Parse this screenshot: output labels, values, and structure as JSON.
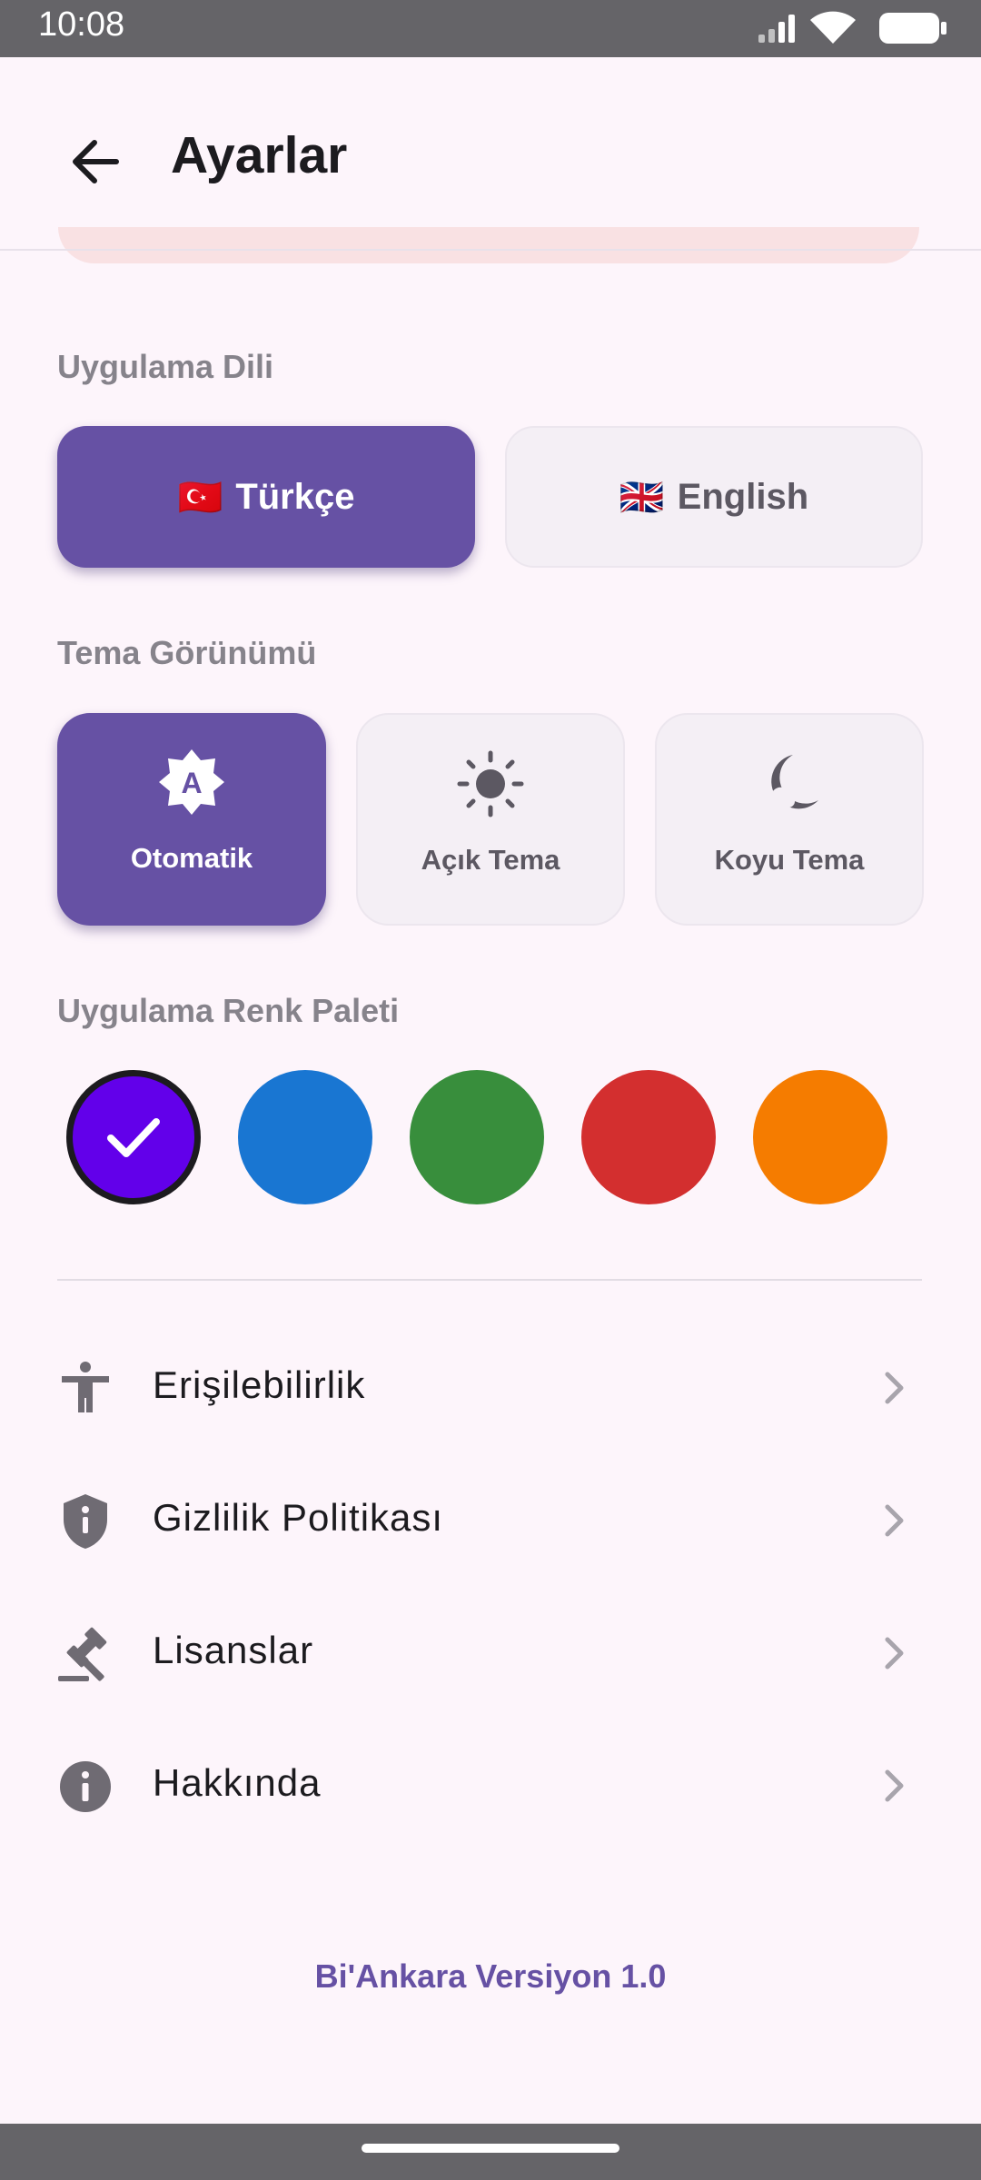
{
  "status_bar": {
    "time": "10:08",
    "icons": [
      "signal-icon",
      "wifi-icon",
      "battery-icon"
    ]
  },
  "app_bar": {
    "title": "Ayarlar",
    "back_icon": "arrow-back-icon"
  },
  "language": {
    "label": "Uygulama Dili",
    "options": [
      {
        "flag": "🇹🇷",
        "label": "Türkçe",
        "selected": true
      },
      {
        "flag": "🇬🇧",
        "label": "English",
        "selected": false
      }
    ]
  },
  "theme": {
    "label": "Tema Görünümü",
    "options": [
      {
        "icon": "brightness-auto-icon",
        "label": "Otomatik",
        "selected": true
      },
      {
        "icon": "sun-icon",
        "label": "Açık Tema",
        "selected": false
      },
      {
        "icon": "moon-icon",
        "label": "Koyu Tema",
        "selected": false
      }
    ]
  },
  "palette": {
    "label": "Uygulama Renk Paleti",
    "colors": [
      "#6200ea",
      "#1976d2",
      "#388e3c",
      "#d32f2f",
      "#f57c00"
    ],
    "selected_index": 0
  },
  "menu": [
    {
      "icon": "accessibility-icon",
      "label": "Erişilebilirlik"
    },
    {
      "icon": "shield-icon",
      "label": "Gizlilik Politikası"
    },
    {
      "icon": "gavel-icon",
      "label": "Lisanslar"
    },
    {
      "icon": "info-icon",
      "label": "Hakkında"
    }
  ],
  "footer": {
    "version": "Bi'Ankara Versiyon 1.0"
  },
  "colors": {
    "accent": "#6651a4",
    "background": "#fdf5fb",
    "system_bar": "#656468"
  }
}
